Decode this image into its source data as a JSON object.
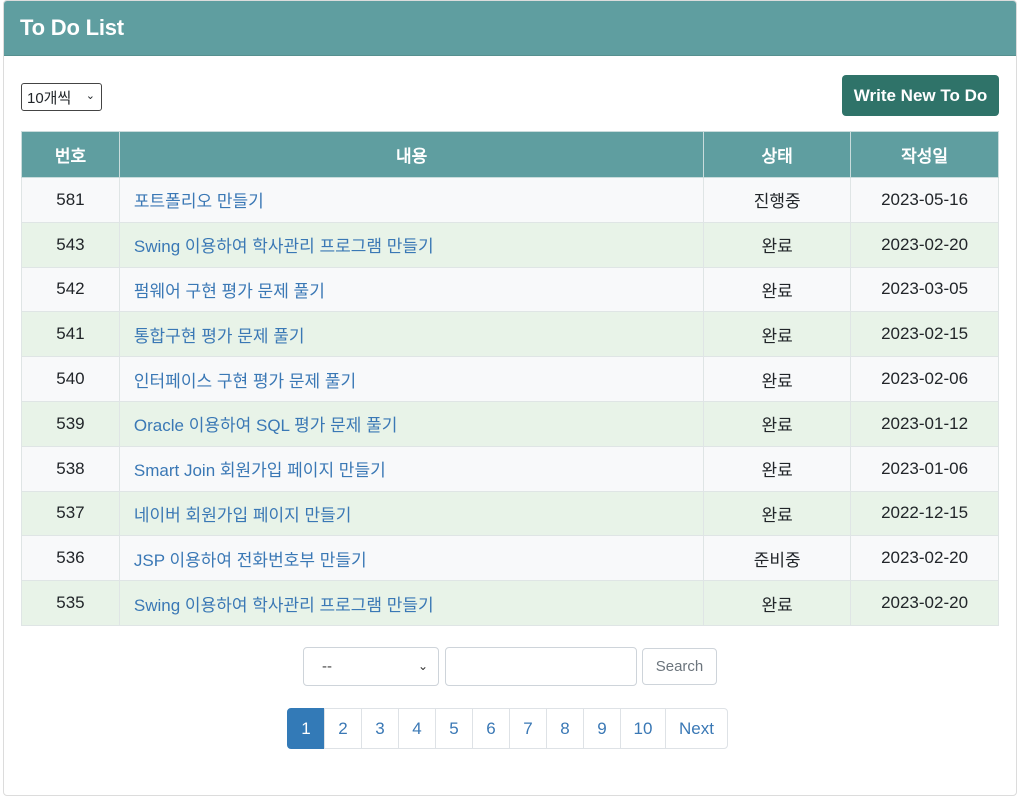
{
  "header": {
    "title": "To Do List"
  },
  "toolbar": {
    "page_size": "10개씩",
    "write_label": "Write New To Do"
  },
  "table": {
    "columns": [
      "번호",
      "내용",
      "상태",
      "작성일"
    ],
    "rows": [
      {
        "num": "581",
        "content": "포트폴리오 만들기",
        "status": "진행중",
        "date": "2023-05-16"
      },
      {
        "num": "543",
        "content": "Swing 이용하여 학사관리 프로그램 만들기",
        "status": "완료",
        "date": "2023-02-20"
      },
      {
        "num": "542",
        "content": "펌웨어 구현 평가 문제 풀기",
        "status": "완료",
        "date": "2023-03-05"
      },
      {
        "num": "541",
        "content": "통합구현 평가 문제 풀기",
        "status": "완료",
        "date": "2023-02-15"
      },
      {
        "num": "540",
        "content": "인터페이스 구현 평가 문제 풀기",
        "status": "완료",
        "date": "2023-02-06"
      },
      {
        "num": "539",
        "content": "Oracle 이용하여 SQL 평가 문제 풀기",
        "status": "완료",
        "date": "2023-01-12"
      },
      {
        "num": "538",
        "content": "Smart Join 회원가입 페이지 만들기",
        "status": "완료",
        "date": "2023-01-06"
      },
      {
        "num": "537",
        "content": "네이버 회원가입 페이지 만들기",
        "status": "완료",
        "date": "2022-12-15"
      },
      {
        "num": "536",
        "content": "JSP 이용하여 전화번호부 만들기",
        "status": "준비중",
        "date": "2023-02-20"
      },
      {
        "num": "535",
        "content": "Swing 이용하여 학사관리 프로그램 만들기",
        "status": "완료",
        "date": "2023-02-20"
      }
    ]
  },
  "search": {
    "type_value": "--",
    "query": "",
    "button_label": "Search"
  },
  "pagination": {
    "pages": [
      "1",
      "2",
      "3",
      "4",
      "5",
      "6",
      "7",
      "8",
      "9",
      "10"
    ],
    "active": "1",
    "next_label": "Next"
  },
  "colors": {
    "header_bg": "#5f9ea0",
    "write_button_bg": "#2f7369",
    "link": "#3a78b5",
    "active_page": "#337ab7",
    "row_alt": "#e8f3e8"
  }
}
